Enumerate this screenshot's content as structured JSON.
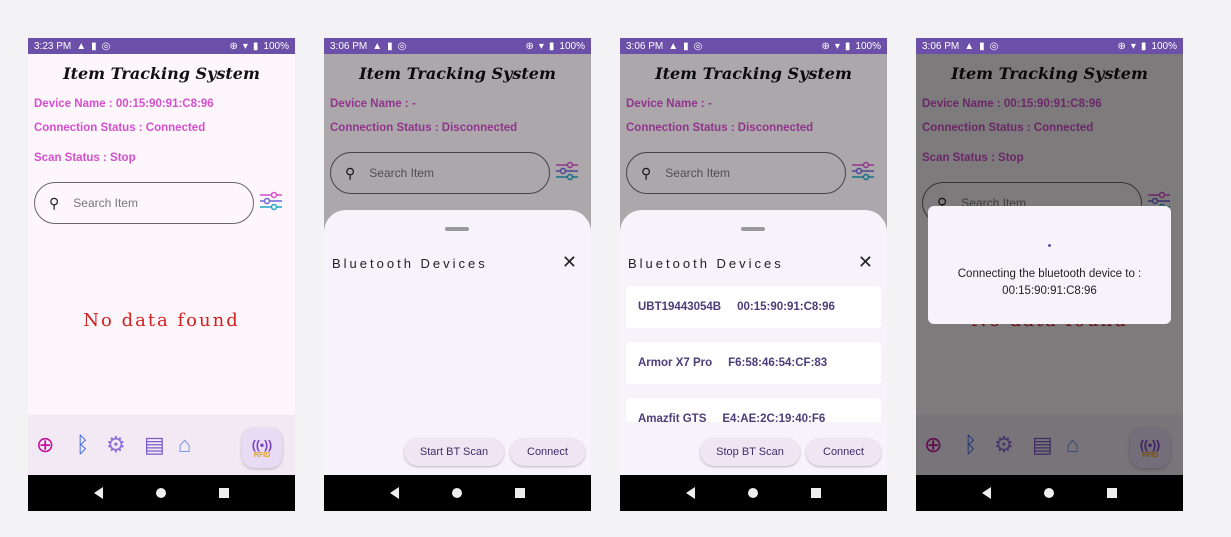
{
  "status_bars": [
    {
      "time": "3:23 PM",
      "battery": "100%"
    },
    {
      "time": "3:06 PM",
      "battery": "100%"
    },
    {
      "time": "3:06 PM",
      "battery": "100%"
    },
    {
      "time": "3:06 PM",
      "battery": "100%"
    }
  ],
  "app": {
    "title": "Item Tracking System",
    "search_placeholder": "Search Item",
    "no_data": "No data found"
  },
  "screens": [
    {
      "device_name": "Device Name : 00:15:90:91:C8:96",
      "connection_status": "Connection Status :  Connected",
      "scan_status": "Scan Status : Stop"
    },
    {
      "device_name": "Device Name : -",
      "connection_status": "Connection Status :  Disconnected"
    },
    {
      "device_name": "Device Name : -",
      "connection_status": "Connection Status :  Disconnected"
    },
    {
      "device_name": "Device Name : 00:15:90:91:C8:96",
      "connection_status": "Connection Status :  Connected",
      "scan_status": "Scan Status : Stop"
    }
  ],
  "bottom_nav": {
    "rfid_label": "RFID",
    "rfid_glyph": "((•))",
    "icons": [
      "add-circle-icon",
      "bluetooth-icon",
      "settings-icon",
      "notes-icon",
      "home-icon",
      "rfid-icon"
    ],
    "colors": {
      "add": "#c0129f",
      "bluetooth": "#3a63e0",
      "settings": "#8f6fd6",
      "notes": "#7b5bc7",
      "home": "#6a8ee0"
    }
  },
  "sheet": {
    "title": "Bluetooth Devices",
    "close_glyph": "✕",
    "start_scan": "Start BT Scan",
    "stop_scan": "Stop BT Scan",
    "connect": "Connect",
    "devices": [
      {
        "name": "UBT19443054B",
        "address": "00:15:90:91:C8:96"
      },
      {
        "name": "Armor X7 Pro",
        "address": "F6:58:46:54:CF:83"
      },
      {
        "name": "Amazfit GTS",
        "address": "E4:AE:2C:19:40:F6"
      }
    ]
  },
  "dialog": {
    "message_line1": "Connecting the bluetooth device to :",
    "message_line2": "00:15:90:91:C8:96"
  },
  "theme": {
    "status_bar": "#6b4fa8",
    "accent_text": "#d64fd0",
    "no_data": "#d32020"
  }
}
